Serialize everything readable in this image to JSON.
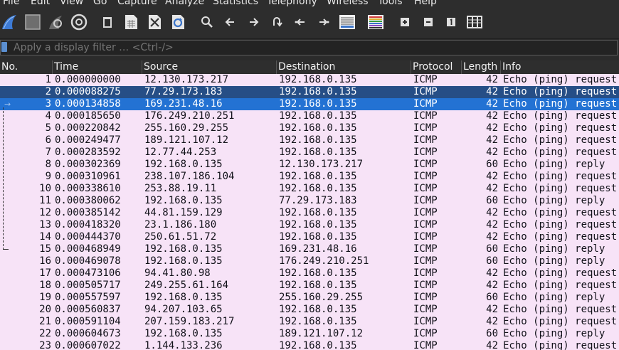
{
  "menu": [
    "File",
    "Edit",
    "View",
    "Go",
    "Capture",
    "Analyze",
    "Statistics",
    "Telephony",
    "Wireless",
    "Tools",
    "Help"
  ],
  "filter": {
    "placeholder": "Apply a display filter … <Ctrl-/>"
  },
  "columns": [
    "No.",
    "Time",
    "Source",
    "Destination",
    "Protocol",
    "Length",
    "Info"
  ],
  "selected_row": 3,
  "hovered_row": 2,
  "packets": [
    {
      "no": "1",
      "time": "0.000000000",
      "src": "12.130.173.217",
      "dst": "192.168.0.135",
      "proto": "ICMP",
      "len": "42",
      "info": "Echo (ping) request"
    },
    {
      "no": "2",
      "time": "0.000088275",
      "src": "77.29.173.183",
      "dst": "192.168.0.135",
      "proto": "ICMP",
      "len": "42",
      "info": "Echo (ping) request"
    },
    {
      "no": "3",
      "time": "0.000134858",
      "src": "169.231.48.16",
      "dst": "192.168.0.135",
      "proto": "ICMP",
      "len": "42",
      "info": "Echo (ping) request"
    },
    {
      "no": "4",
      "time": "0.000185650",
      "src": "176.249.210.251",
      "dst": "192.168.0.135",
      "proto": "ICMP",
      "len": "42",
      "info": "Echo (ping) request"
    },
    {
      "no": "5",
      "time": "0.000220842",
      "src": "255.160.29.255",
      "dst": "192.168.0.135",
      "proto": "ICMP",
      "len": "42",
      "info": "Echo (ping) request"
    },
    {
      "no": "6",
      "time": "0.000249477",
      "src": "189.121.107.12",
      "dst": "192.168.0.135",
      "proto": "ICMP",
      "len": "42",
      "info": "Echo (ping) request"
    },
    {
      "no": "7",
      "time": "0.000283592",
      "src": "12.77.44.253",
      "dst": "192.168.0.135",
      "proto": "ICMP",
      "len": "42",
      "info": "Echo (ping) request"
    },
    {
      "no": "8",
      "time": "0.000302369",
      "src": "192.168.0.135",
      "dst": "12.130.173.217",
      "proto": "ICMP",
      "len": "60",
      "info": "Echo (ping) reply"
    },
    {
      "no": "9",
      "time": "0.000310961",
      "src": "238.107.186.104",
      "dst": "192.168.0.135",
      "proto": "ICMP",
      "len": "42",
      "info": "Echo (ping) request"
    },
    {
      "no": "10",
      "time": "0.000338610",
      "src": "253.88.19.11",
      "dst": "192.168.0.135",
      "proto": "ICMP",
      "len": "42",
      "info": "Echo (ping) request"
    },
    {
      "no": "11",
      "time": "0.000380062",
      "src": "192.168.0.135",
      "dst": "77.29.173.183",
      "proto": "ICMP",
      "len": "60",
      "info": "Echo (ping) reply"
    },
    {
      "no": "12",
      "time": "0.000385142",
      "src": "44.81.159.129",
      "dst": "192.168.0.135",
      "proto": "ICMP",
      "len": "42",
      "info": "Echo (ping) request"
    },
    {
      "no": "13",
      "time": "0.000418320",
      "src": "23.1.186.180",
      "dst": "192.168.0.135",
      "proto": "ICMP",
      "len": "42",
      "info": "Echo (ping) request"
    },
    {
      "no": "14",
      "time": "0.000444370",
      "src": "250.61.51.72",
      "dst": "192.168.0.135",
      "proto": "ICMP",
      "len": "42",
      "info": "Echo (ping) request"
    },
    {
      "no": "15",
      "time": "0.000468949",
      "src": "192.168.0.135",
      "dst": "169.231.48.16",
      "proto": "ICMP",
      "len": "60",
      "info": "Echo (ping) reply"
    },
    {
      "no": "16",
      "time": "0.000469078",
      "src": "192.168.0.135",
      "dst": "176.249.210.251",
      "proto": "ICMP",
      "len": "60",
      "info": "Echo (ping) reply"
    },
    {
      "no": "17",
      "time": "0.000473106",
      "src": "94.41.80.98",
      "dst": "192.168.0.135",
      "proto": "ICMP",
      "len": "42",
      "info": "Echo (ping) request"
    },
    {
      "no": "18",
      "time": "0.000505717",
      "src": "249.255.61.164",
      "dst": "192.168.0.135",
      "proto": "ICMP",
      "len": "42",
      "info": "Echo (ping) request"
    },
    {
      "no": "19",
      "time": "0.000557597",
      "src": "192.168.0.135",
      "dst": "255.160.29.255",
      "proto": "ICMP",
      "len": "60",
      "info": "Echo (ping) reply"
    },
    {
      "no": "20",
      "time": "0.000560837",
      "src": "94.207.103.65",
      "dst": "192.168.0.135",
      "proto": "ICMP",
      "len": "42",
      "info": "Echo (ping) request"
    },
    {
      "no": "21",
      "time": "0.000591104",
      "src": "207.159.183.217",
      "dst": "192.168.0.135",
      "proto": "ICMP",
      "len": "42",
      "info": "Echo (ping) request"
    },
    {
      "no": "22",
      "time": "0.000604673",
      "src": "192.168.0.135",
      "dst": "189.121.107.12",
      "proto": "ICMP",
      "len": "60",
      "info": "Echo (ping) reply"
    },
    {
      "no": "23",
      "time": "0.000607022",
      "src": "1.144.133.236",
      "dst": "192.168.0.135",
      "proto": "ICMP",
      "len": "42",
      "info": "Echo (ping) request"
    }
  ]
}
